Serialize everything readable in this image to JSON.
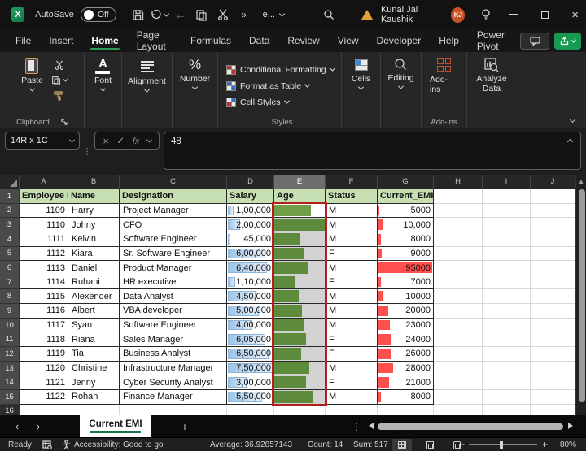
{
  "titlebar": {
    "logo": "X",
    "autosave_label": "AutoSave",
    "autosave_state": "Off",
    "overflow_chevron": "»",
    "doc_name": "e...",
    "user_name": "Kunal Jai Kaushik",
    "avatar_initials": "KJ"
  },
  "active_tab": "Home",
  "ribbon_tabs": [
    "File",
    "Insert",
    "Home",
    "Page Layout",
    "Formulas",
    "Data",
    "Review",
    "View",
    "Developer",
    "Help",
    "Power Pivot"
  ],
  "ribbon": {
    "paste_label": "Paste",
    "clipboard_group": "Clipboard",
    "font_group": "Font",
    "alignment_group": "Alignment",
    "number_group": "Number",
    "number_glyph": "%",
    "styles": {
      "items": [
        "Conditional Formatting",
        "Format as Table",
        "Cell Styles"
      ],
      "label": "Styles"
    },
    "cells_group": "Cells",
    "editing_group": "Editing",
    "addins_button": "Add-ins",
    "addins_group": "Add-ins",
    "analyze_button": "Analyze Data"
  },
  "formula_bar": {
    "name_box": "14R x 1C",
    "fx_label": "fx",
    "cancel_glyph": "×",
    "enter_glyph": "✓",
    "value": "48"
  },
  "sheet": {
    "column_letters": [
      "A",
      "B",
      "C",
      "D",
      "E",
      "F",
      "G",
      "H",
      "I",
      "J"
    ],
    "selected_column": "E",
    "header_row_number": "1",
    "headers": [
      "Employee ID",
      "Name",
      "Designation",
      "Salary",
      "Age",
      "Status",
      "Current_EMI"
    ],
    "rows": [
      {
        "n": "2",
        "id": "1109",
        "name": "Harry",
        "designation": "Project Manager",
        "salary": "1,00,000",
        "salary_pct": 13,
        "age_pct": 72,
        "status": "M",
        "emi": "5000",
        "emi_pct": 5,
        "active": true
      },
      {
        "n": "3",
        "id": "1110",
        "name": "Johny",
        "designation": "CFO",
        "salary": "2,00,000",
        "salary_pct": 27,
        "age_pct": 100,
        "status": "M",
        "emi": "10,000",
        "emi_pct": 11
      },
      {
        "n": "4",
        "id": "1111",
        "name": "Kelvin",
        "designation": "Software Engineer",
        "salary": "45,000",
        "salary_pct": 6,
        "age_pct": 52,
        "status": "M",
        "emi": "8000",
        "emi_pct": 8
      },
      {
        "n": "5",
        "id": "1112",
        "name": "Kiara",
        "designation": "Sr. Software Engineer",
        "salary": "6,00,000",
        "salary_pct": 80,
        "age_pct": 58,
        "status": "F",
        "emi": "9000",
        "emi_pct": 9
      },
      {
        "n": "6",
        "id": "1113",
        "name": "Daniel",
        "designation": "Product Manager",
        "salary": "6,40,000",
        "salary_pct": 85,
        "age_pct": 68,
        "status": "M",
        "emi": "95000",
        "emi_pct": 100
      },
      {
        "n": "7",
        "id": "1114",
        "name": "Ruhani",
        "designation": "HR executive",
        "salary": "1,10,000",
        "salary_pct": 15,
        "age_pct": 42,
        "status": "F",
        "emi": "7000",
        "emi_pct": 7
      },
      {
        "n": "8",
        "id": "1115",
        "name": "Alexender",
        "designation": "Data Analyst",
        "salary": "4,50,000",
        "salary_pct": 60,
        "age_pct": 48,
        "status": "M",
        "emi": "10000",
        "emi_pct": 11
      },
      {
        "n": "9",
        "id": "1116",
        "name": "Albert",
        "designation": "VBA developer",
        "salary": "5,00,000",
        "salary_pct": 67,
        "age_pct": 55,
        "status": "M",
        "emi": "20000",
        "emi_pct": 21
      },
      {
        "n": "10",
        "id": "1117",
        "name": "Syan",
        "designation": "Software Engineer",
        "salary": "4,00,000",
        "salary_pct": 53,
        "age_pct": 60,
        "status": "M",
        "emi": "23000",
        "emi_pct": 24
      },
      {
        "n": "11",
        "id": "1118",
        "name": "Riana",
        "designation": "Sales Manager",
        "salary": "6,05,000",
        "salary_pct": 81,
        "age_pct": 63,
        "status": "F",
        "emi": "24000",
        "emi_pct": 25
      },
      {
        "n": "12",
        "id": "1119",
        "name": "Tia",
        "designation": "Business Analyst",
        "salary": "6,50,000",
        "salary_pct": 87,
        "age_pct": 53,
        "status": "F",
        "emi": "26000",
        "emi_pct": 27
      },
      {
        "n": "13",
        "id": "1120",
        "name": "Christine",
        "designation": "Infrastructure Manager",
        "salary": "7,50,000",
        "salary_pct": 100,
        "age_pct": 70,
        "status": "M",
        "emi": "28000",
        "emi_pct": 29
      },
      {
        "n": "14",
        "id": "1121",
        "name": "Jenny",
        "designation": "Cyber Security Analyst",
        "salary": "3,00,000",
        "salary_pct": 40,
        "age_pct": 63,
        "status": "F",
        "emi": "21000",
        "emi_pct": 22
      },
      {
        "n": "15",
        "id": "1122",
        "name": "Rohan",
        "designation": "Finance Manager",
        "salary": "5,50,000",
        "salary_pct": 73,
        "age_pct": 76,
        "status": "M",
        "emi": "8000",
        "emi_pct": 8
      }
    ],
    "trailing_row_number": "16"
  },
  "sheettabs": {
    "prev_glyph": "‹",
    "next_glyph": "›",
    "active_sheet": "Current EMI",
    "add_glyph": "+",
    "dots_glyph": "⋮"
  },
  "statusbar": {
    "mode": "Ready",
    "accessibility": "Accessibility: Good to go",
    "average": "Average: 36.92857143",
    "count": "Count: 14",
    "sum": "Sum: 517",
    "zoom_minus": "−",
    "zoom_plus": "+",
    "zoom_level": "80%"
  },
  "colors": {
    "accent_green": "#2e9b5b",
    "share_green": "#169a52",
    "header_fill": "#c6e0b4",
    "bar_green": "#5e8b3b",
    "bar_green_active": "#6f9e47",
    "bar_green_rest": "#d2d2d2",
    "bar_blue": "#9dc3e6",
    "bar_red": "#ff5050",
    "selection_border": "#b11f1f"
  }
}
